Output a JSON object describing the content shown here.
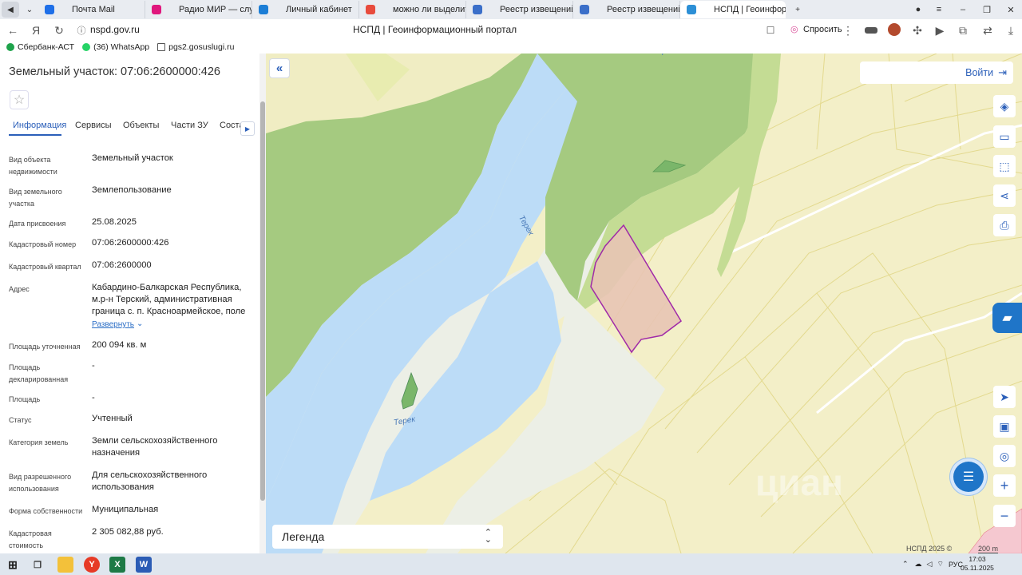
{
  "browser": {
    "tabs": [
      {
        "label": "Почта Mail",
        "favicon_color": "#1e6fe8",
        "width": 132
      },
      {
        "label": "Радио МИР — слуш",
        "favicon_color": "#e0177d",
        "width": 132
      },
      {
        "label": "Личный кабинет",
        "favicon_color": "#1c7ed6",
        "width": 132
      },
      {
        "label": "можно ли выделить доле",
        "favicon_color": "#e84b3c",
        "width": 132
      },
      {
        "label": "Реестр извещений",
        "favicon_color": "#3b6fc9",
        "width": 132
      },
      {
        "label": "Реестр извещений",
        "favicon_color": "#3b6fc9",
        "width": 132
      },
      {
        "label": "НСПД | Геоинформац",
        "favicon_color": "#2c8fd6",
        "width": 132
      }
    ],
    "url": "nspd.gov.ru",
    "page_title": "НСПД | Геоинформационный портал",
    "ask_label": "Спросить",
    "bookmarks": [
      "Сбербанк-АСТ",
      "(36) WhatsApp",
      "pgs2.gosuslugi.ru"
    ]
  },
  "panel": {
    "title": "Земельный участок: 07:06:2600000:426",
    "tabs": [
      "Информация",
      "Сервисы",
      "Объекты",
      "Части ЗУ",
      "Соста"
    ],
    "properties": [
      {
        "label": "Вид объекта недвижимости",
        "value": "Земельный участок"
      },
      {
        "label": "Вид земельного участка",
        "value": "Землепользование"
      },
      {
        "label": "Дата присвоения",
        "value": "25.08.2025"
      },
      {
        "label": "Кадастровый номер",
        "value": "07:06:2600000:426"
      },
      {
        "label": "Кадастровый квартал",
        "value": "07:06:2600000"
      },
      {
        "label": "Адрес",
        "value": "Кабардино-Балкарская Республика, м.р-н Терский, административная граница с. п. Красноармейское, поле"
      },
      {
        "label": "Площадь уточненная",
        "value": "200 094 кв. м"
      },
      {
        "label": "Площадь декларированная",
        "value": "-"
      },
      {
        "label": "Площадь",
        "value": "-"
      },
      {
        "label": "Статус",
        "value": "Учтенный"
      },
      {
        "label": "Категория земель",
        "value": "Земли сельскохозяйственного назначения"
      },
      {
        "label": "Вид разрешенного использования",
        "value": "Для сельскохозяйственного использования"
      },
      {
        "label": "Форма собственности",
        "value": "Муниципальная"
      },
      {
        "label": "Кадастровая стоимость",
        "value": "2 305 082,88 руб."
      }
    ],
    "expand_label": "Развернуть"
  },
  "map": {
    "login_label": "Войти",
    "legend_label": "Легенда",
    "river_name": "Терек",
    "credit": "НСПД 2025 ©",
    "scale": "200 m",
    "watermark": "циан",
    "colors": {
      "background": "#f3efc8",
      "forest": "#a5ca80",
      "river": "#bcdcf7",
      "parcel_fill": "#e8c4b4",
      "parcel_stroke": "#a02aa8",
      "accent": "#2b5fb9"
    }
  },
  "taskbar": {
    "language": "РУС",
    "time": "17:03",
    "date": "05.11.2025"
  }
}
